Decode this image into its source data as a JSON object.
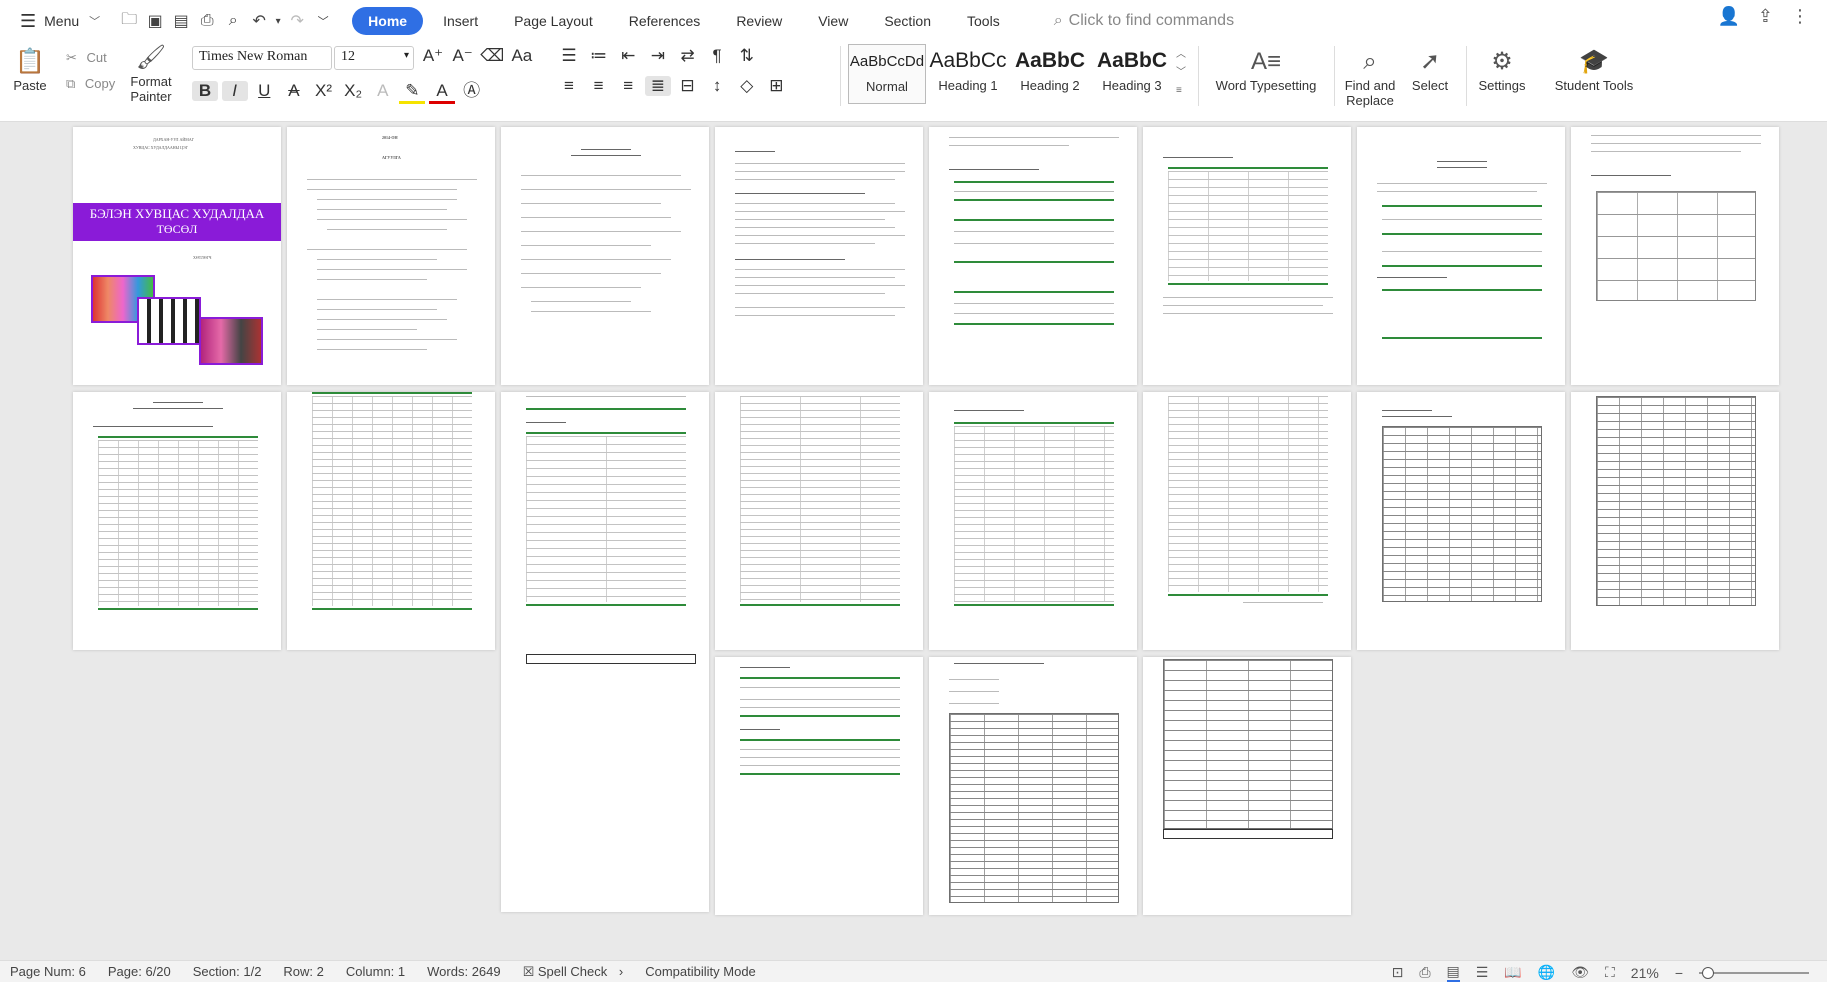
{
  "menubar": {
    "menu_label": "Menu",
    "tabs": [
      {
        "label": "Home",
        "active": true
      },
      {
        "label": "Insert"
      },
      {
        "label": "Page Layout"
      },
      {
        "label": "References"
      },
      {
        "label": "Review"
      },
      {
        "label": "View"
      },
      {
        "label": "Section"
      },
      {
        "label": "Tools"
      }
    ],
    "search_placeholder": "Click to find commands"
  },
  "ribbon": {
    "paste": "Paste",
    "cut": "Cut",
    "copy": "Copy",
    "format_painter_1": "Format",
    "format_painter_2": "Painter",
    "font_name": "Times New Roman",
    "font_size": "12",
    "styles": [
      {
        "sample": "AaBbCcDd",
        "label": "Normal"
      },
      {
        "sample": "AaBbCc",
        "label": "Heading 1"
      },
      {
        "sample": "AaBbC",
        "label": "Heading 2"
      },
      {
        "sample": "AaBbC",
        "label": "Heading 3"
      }
    ],
    "word_typesetting": "Word Typesetting",
    "find_replace_1": "Find and",
    "find_replace_2": "Replace",
    "select": "Select",
    "settings": "Settings",
    "student_tools": "Student Tools"
  },
  "document": {
    "cover_banner_1": "БЭЛЭН ХУВЦАС ХУДАЛДАА",
    "cover_banner_2": "ТӨСӨЛ",
    "toc_title": "АГУУЛГА",
    "year_title": "2014-ОН"
  },
  "statusbar": {
    "page_num": "Page Num: 6",
    "page": "Page: 6/20",
    "section": "Section: 1/2",
    "row": "Row: 2",
    "column": "Column: 1",
    "words": "Words: 2649",
    "spell_check": "Spell Check",
    "compatibility": "Compatibility Mode",
    "zoom": "21%",
    "zoom_level_fraction": 0.21
  },
  "colors": {
    "accent": "#2f6fe4",
    "banner": "#8a1bd8",
    "table_rule": "#2e8b3a"
  }
}
